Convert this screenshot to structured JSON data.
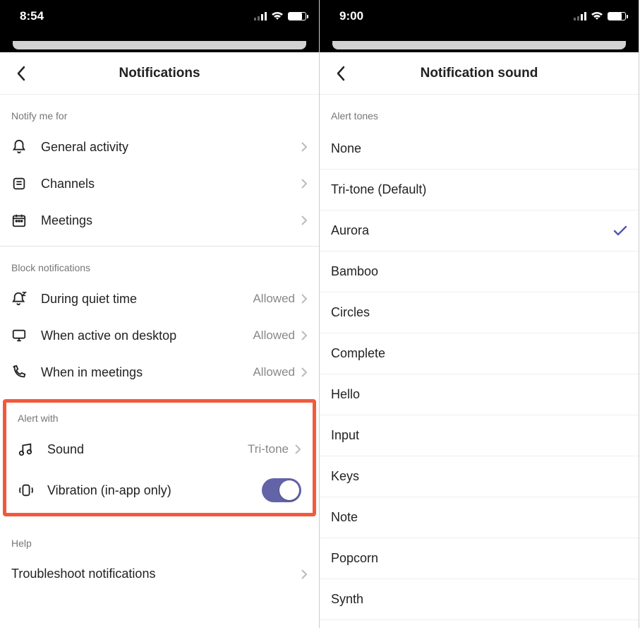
{
  "left": {
    "time": "8:54",
    "title": "Notifications",
    "sections": {
      "notify": {
        "label": "Notify me for",
        "items": [
          {
            "label": "General activity",
            "name": "row-general-activity"
          },
          {
            "label": "Channels",
            "name": "row-channels"
          },
          {
            "label": "Meetings",
            "name": "row-meetings"
          }
        ]
      },
      "block": {
        "label": "Block notifications",
        "items": [
          {
            "label": "During quiet time",
            "value": "Allowed",
            "name": "row-quiet-time"
          },
          {
            "label": "When active on desktop",
            "value": "Allowed",
            "name": "row-active-desktop"
          },
          {
            "label": "When in meetings",
            "value": "Allowed",
            "name": "row-in-meetings"
          }
        ]
      },
      "alert": {
        "label": "Alert with",
        "sound": {
          "label": "Sound",
          "value": "Tri-tone"
        },
        "vibration": {
          "label": "Vibration (in-app only)",
          "on": true
        }
      },
      "help": {
        "label": "Help",
        "item": {
          "label": "Troubleshoot notifications"
        }
      }
    }
  },
  "right": {
    "time": "9:00",
    "title": "Notification sound",
    "section_label": "Alert tones",
    "selected": "Aurora",
    "tones": [
      "None",
      "Tri-tone (Default)",
      "Aurora",
      "Bamboo",
      "Circles",
      "Complete",
      "Hello",
      "Input",
      "Keys",
      "Note",
      "Popcorn",
      "Synth"
    ]
  }
}
